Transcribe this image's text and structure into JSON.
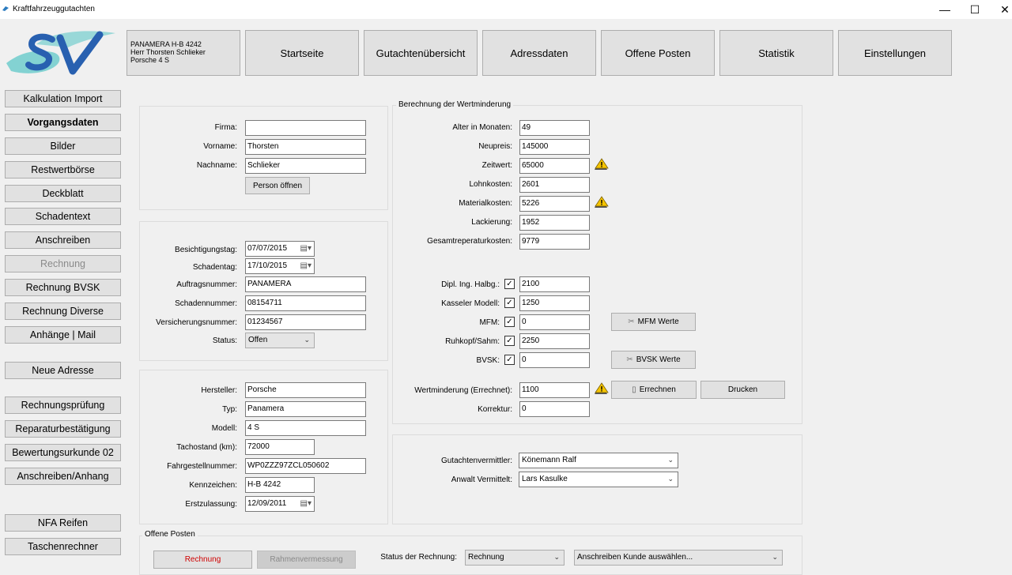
{
  "window": {
    "title": "Kraftfahrzeuggutachten",
    "minimize": "—",
    "maximize": "☐",
    "close": "✕"
  },
  "vehicle_summary": {
    "line1": "PANAMERA   H-B 4242",
    "line2": "Herr Thorsten Schlieker",
    "line3": "Porsche 4 S"
  },
  "top_nav": [
    "Startseite",
    "Gutachtenübersicht",
    "Adressdaten",
    "Offene Posten",
    "Statistik",
    "Einstellungen"
  ],
  "sidebar": {
    "items": [
      "Kalkulation Import",
      "Vorgangsdaten",
      "Bilder",
      "Restwertbörse",
      "Deckblatt",
      "Schadentext",
      "Anschreiben",
      "Rechnung",
      "Rechnung BVSK",
      "Rechnung Diverse",
      "Anhänge | Mail",
      "Neue Adresse",
      "Rechnungsprüfung",
      "Reparaturbestätigung",
      "Bewertungsurkunde 02",
      "Anschreiben/Anhang",
      "NFA Reifen",
      "Taschenrechner"
    ]
  },
  "person": {
    "firma_label": "Firma:",
    "firma": "",
    "vorname_label": "Vorname:",
    "vorname": "Thorsten",
    "nachname_label": "Nachname:",
    "nachname": "Schlieker",
    "open_button": "Person öffnen"
  },
  "case": {
    "besichtigung_label": "Besichtigungstag:",
    "besichtigung": "07/07/2015",
    "schadentag_label": "Schadentag:",
    "schadentag": "17/10/2015",
    "auftrag_label": "Auftragsnummer:",
    "auftrag": "PANAMERA",
    "schaden_label": "Schadennummer:",
    "schaden": "08154711",
    "versicherung_label": "Versicherungsnummer:",
    "versicherung": "01234567",
    "status_label": "Status:",
    "status": "Offen"
  },
  "car": {
    "hersteller_label": "Hersteller:",
    "hersteller": "Porsche",
    "typ_label": "Typ:",
    "typ": "Panamera",
    "modell_label": "Modell:",
    "modell": "4 S",
    "tacho_label": "Tachostand (km):",
    "tacho": "72000",
    "fgn_label": "Fahrgestellnummer:",
    "fgn": "WP0ZZZ97ZCL050602",
    "kennzeichen_label": "Kennzeichen:",
    "kennzeichen": "H-B 4242",
    "erstzulassung_label": "Erstzulassung:",
    "erstzulassung": "12/09/2011"
  },
  "wertminderung": {
    "group_title": "Berechnung der Wertminderung",
    "alter_label": "Alter in Monaten:",
    "alter": "49",
    "neupreis_label": "Neupreis:",
    "neupreis": "145000",
    "zeitwert_label": "Zeitwert:",
    "zeitwert": "65000",
    "lohn_label": "Lohnkosten:",
    "lohn": "2601",
    "material_label": "Materialkosten:",
    "material": "5226",
    "lackierung_label": "Lackierung:",
    "lackierung": "1952",
    "gesamt_label": "Gesamtreperaturkosten:",
    "gesamt": "9779",
    "halbg_label": "Dipl. Ing. Halbg.:",
    "halbg": "2100",
    "kassel_label": "Kasseler Modell:",
    "kassel": "1250",
    "mfm_label": "MFM:",
    "mfm": "0",
    "ruhkopf_label": "Ruhkopf/Sahm:",
    "ruhkopf": "2250",
    "bvsk_label": "BVSK:",
    "bvsk": "0",
    "mfm_button": "MFM Werte",
    "bvsk_button": "BVSK Werte",
    "errechnet_label": "Wertminderung (Errechnet):",
    "errechnet": "1100",
    "korrektur_label": "Korrektur:",
    "korrektur": "0",
    "errechnen_button": "Errechnen",
    "drucken_button": "Drucken",
    "check_mark": "✓"
  },
  "vermittler": {
    "gutachten_label": "Gutachtenvermittler:",
    "gutachten": "Könemann Ralf",
    "anwalt_label": "Anwalt Vermittelt:",
    "anwalt": "Lars Kasulke"
  },
  "offene_posten": {
    "group_title": "Offene Posten",
    "rechnung_button": "Rechnung",
    "rahmen_button": "Rahmenvermessung",
    "status_label": "Status der Rechnung:",
    "status": "Rechnung",
    "anschreiben": "Anschreiben Kunde auswählen..."
  }
}
